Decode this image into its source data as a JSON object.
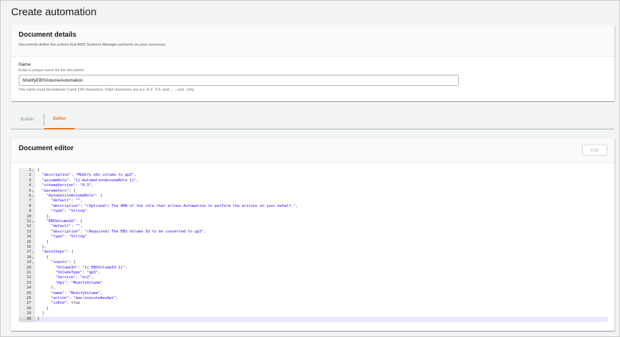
{
  "page": {
    "title": "Create automation"
  },
  "details": {
    "heading": "Document details",
    "description": "Documents define the actions that AWS Systems Manager performs on your resources.",
    "name_label": "Name",
    "name_description": "Enter a unique name for the document.",
    "name_value": "ModifyEBSVolumeAutomation",
    "name_constraint": "The name must be between 3 and 128 characters. Valid characters are a-z, A-Z, 0-9, and _, -, and . only"
  },
  "tabs": [
    {
      "label": "Builder",
      "active": false
    },
    {
      "label": "Editor",
      "active": true
    }
  ],
  "editor": {
    "heading": "Document editor",
    "edit_label": "Edit",
    "lines": [
      {
        "n": "1",
        "fold": true,
        "text": "{"
      },
      {
        "n": "2",
        "fold": false,
        "text": "  \"description\": \"Modify ebs volume to gp3\","
      },
      {
        "n": "3",
        "fold": false,
        "text": "  \"assumeRole\": \"{{ AutomationAssumeRole }}\","
      },
      {
        "n": "4",
        "fold": false,
        "text": "  \"schemaVersion\": \"0.3\","
      },
      {
        "n": "5",
        "fold": true,
        "text": "  \"parameters\": {"
      },
      {
        "n": "6",
        "fold": true,
        "text": "    \"AutomationAssumeRole\": {"
      },
      {
        "n": "7",
        "fold": false,
        "text": "      \"default\": \"\","
      },
      {
        "n": "8",
        "fold": false,
        "text": "      \"description\": \"(Optional) The ARN of the role that allows Automation to perform the actions on your behalf.\","
      },
      {
        "n": "9",
        "fold": false,
        "text": "      \"type\": \"String\""
      },
      {
        "n": "10",
        "fold": false,
        "text": "    },"
      },
      {
        "n": "11",
        "fold": true,
        "text": "    \"EBSVolumeId\": {"
      },
      {
        "n": "12",
        "fold": false,
        "text": "      \"default\": \"\","
      },
      {
        "n": "13",
        "fold": false,
        "text": "      \"description\": \"(Required) The EBS Volume Id to be converted to gp3\","
      },
      {
        "n": "14",
        "fold": false,
        "text": "      \"type\": \"String\""
      },
      {
        "n": "15",
        "fold": false,
        "text": "    }"
      },
      {
        "n": "16",
        "fold": false,
        "text": "  },"
      },
      {
        "n": "17",
        "fold": true,
        "text": "  \"mainSteps\": ["
      },
      {
        "n": "18",
        "fold": true,
        "text": "    {"
      },
      {
        "n": "19",
        "fold": true,
        "text": "      \"inputs\": {"
      },
      {
        "n": "20",
        "fold": false,
        "text": "        \"VolumeId\": \"{{ EBSVolumeId }}\","
      },
      {
        "n": "21",
        "fold": false,
        "text": "        \"VolumeType\": \"gp3\","
      },
      {
        "n": "22",
        "fold": false,
        "text": "        \"Service\": \"ec2\","
      },
      {
        "n": "23",
        "fold": false,
        "text": "        \"Api\": \"ModifyVolume\""
      },
      {
        "n": "24",
        "fold": false,
        "text": "      },"
      },
      {
        "n": "25",
        "fold": false,
        "text": "      \"name\": \"ModifyVolume\","
      },
      {
        "n": "26",
        "fold": false,
        "text": "      \"action\": \"aws:executeAwsApi\","
      },
      {
        "n": "27",
        "fold": false,
        "text": "      \"isEnd\": true"
      },
      {
        "n": "28",
        "fold": false,
        "text": "    }"
      },
      {
        "n": "29",
        "fold": false,
        "text": "  ]"
      },
      {
        "n": "30",
        "fold": false,
        "text": "}"
      }
    ],
    "active_line": "30",
    "colors": {
      "key": "#2a00ff",
      "accent": "#ec7211"
    }
  }
}
